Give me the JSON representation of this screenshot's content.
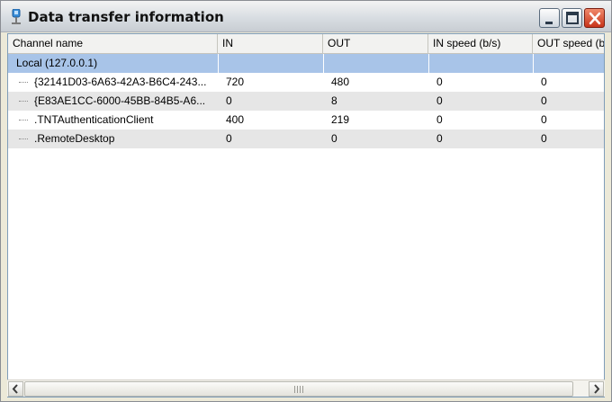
{
  "window": {
    "title": "Data transfer information",
    "icons": {
      "app": "network-icon",
      "minimize": "minimize-icon",
      "maximize": "maximize-icon",
      "close": "close-icon"
    }
  },
  "table": {
    "columns": [
      "Channel name",
      "IN",
      "OUT",
      "IN speed (b/s)",
      "OUT speed (b"
    ],
    "group": {
      "label": "Local (127.0.0.1)"
    },
    "rows": [
      {
        "name": "{32141D03-6A63-42A3-B6C4-243...",
        "in": "720",
        "out": "480",
        "in_speed": "0",
        "out_speed": "0"
      },
      {
        "name": "{E83AE1CC-6000-45BB-84B5-A6...",
        "in": "0",
        "out": "8",
        "in_speed": "0",
        "out_speed": "0"
      },
      {
        "name": ".TNTAuthenticationClient",
        "in": "400",
        "out": "219",
        "in_speed": "0",
        "out_speed": "0"
      },
      {
        "name": ".RemoteDesktop",
        "in": "0",
        "out": "0",
        "in_speed": "0",
        "out_speed": "0"
      }
    ]
  },
  "colors": {
    "selected_group": "#a8c4e8",
    "alt_row": "#e6e6e6",
    "close_button": "#c8341a"
  }
}
